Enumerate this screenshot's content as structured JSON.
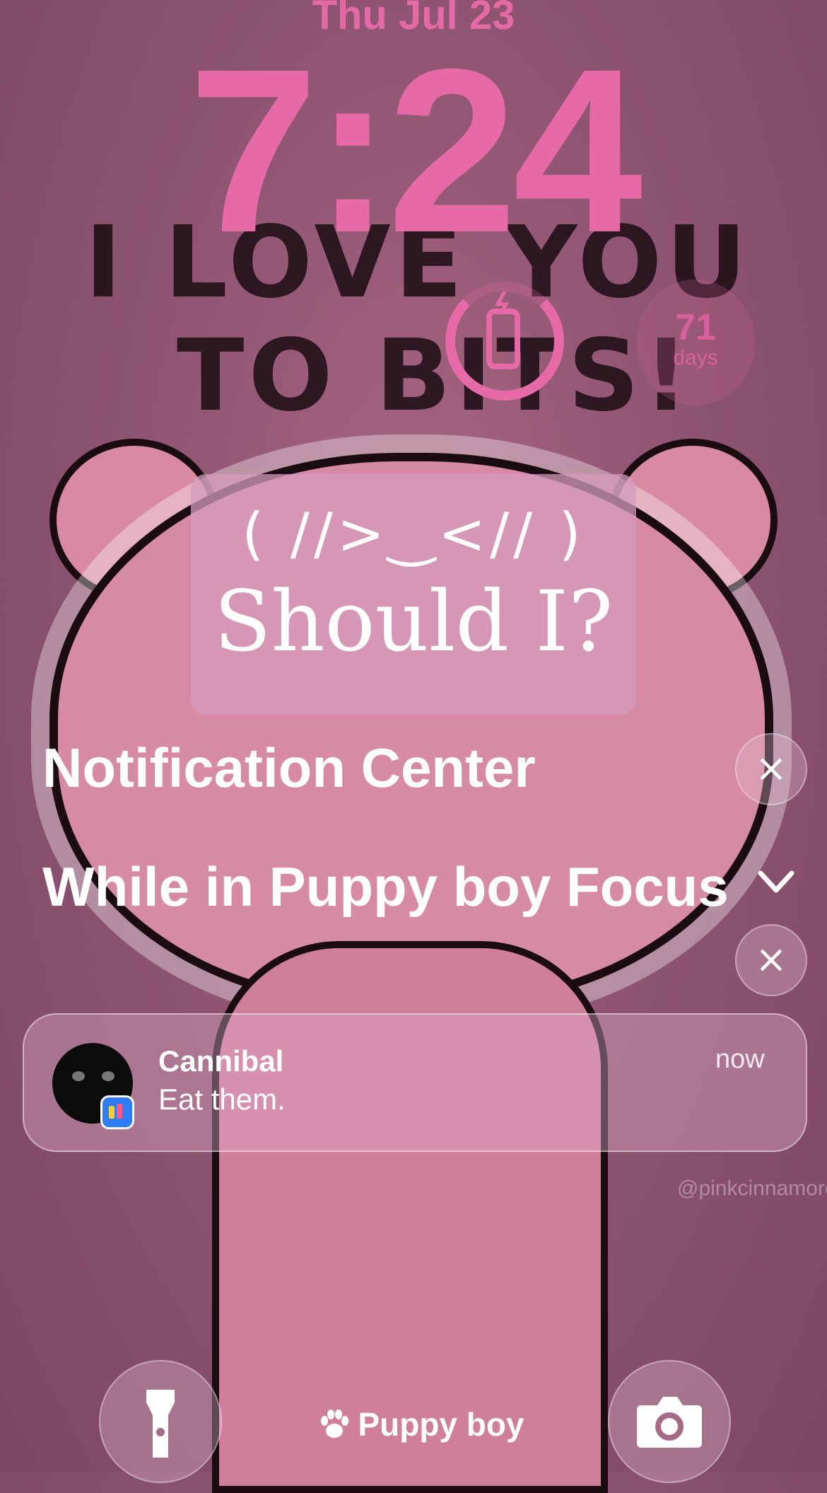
{
  "lockscreen": {
    "date": "Thu Jul 23",
    "time": "7:24",
    "widgets": {
      "battery_icon": "phone-charging-icon",
      "days_count": "71",
      "days_label": "days"
    },
    "wallpaper": {
      "headline_line1": "I LOVE YOU",
      "headline_line2": "TO BITS!",
      "watermark": "@pinkcinnamoroll"
    },
    "note_widget": {
      "kaomoji": "( //>‿<// )",
      "text": "Should I?"
    }
  },
  "notification_center": {
    "title": "Notification Center",
    "focus_section_title": "While in Puppy boy Focus",
    "notification": {
      "app": "Cannibal",
      "message": "Eat them.",
      "time": "now"
    }
  },
  "bottom": {
    "flashlight_icon": "flashlight-icon",
    "camera_icon": "camera-icon",
    "focus_label": "Puppy boy",
    "focus_icon": "paw-icon"
  },
  "colors": {
    "accent_pink": "#e56aa6",
    "background": "#8f5572"
  }
}
